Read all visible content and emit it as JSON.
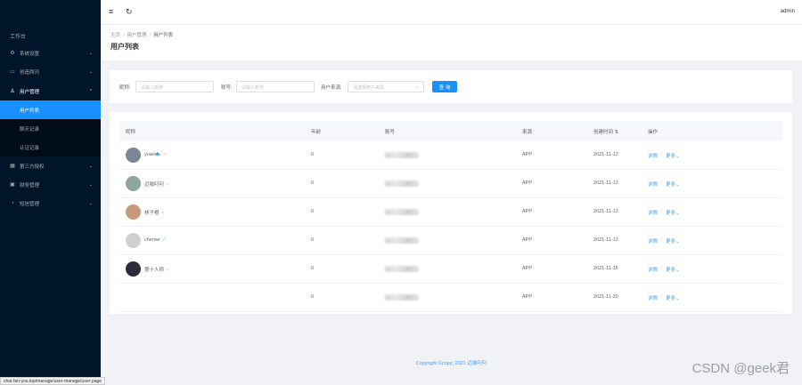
{
  "sidebar": {
    "title": "工作台",
    "items": [
      {
        "label": "系统设置",
        "icon": "gear-icon",
        "glyph": "⚙"
      },
      {
        "label": "创造两河",
        "icon": "monitor-icon",
        "glyph": "▭"
      },
      {
        "label": "用户管理",
        "icon": "user-icon",
        "glyph": "♙"
      },
      {
        "label": "第三方授权",
        "icon": "grid-icon",
        "glyph": "▦"
      },
      {
        "label": "财务管理",
        "icon": "wallet-icon",
        "glyph": "▣"
      },
      {
        "label": "短信管理",
        "icon": "message-icon",
        "glyph": "◔"
      }
    ],
    "sub_items": [
      {
        "label": "用户列表",
        "active": true
      },
      {
        "label": "聊天记录",
        "active": false
      },
      {
        "label": "认证记录",
        "active": false
      }
    ]
  },
  "header": {
    "user": "admin",
    "menu_icon": "≡",
    "refresh_icon": "↻"
  },
  "breadcrumb": {
    "home": "主页",
    "section": "用户管理",
    "current": "用户列表",
    "sep": "/"
  },
  "page_title": "用户列表",
  "search": {
    "nickname_label": "昵称:",
    "nickname_placeholder": "请输入昵称",
    "account_label": "账号:",
    "account_placeholder": "请输入账号",
    "source_label": "用户来源:",
    "source_placeholder": "请选择用户来源",
    "button": "查 询"
  },
  "table": {
    "headers": {
      "nickname": "昵称",
      "age": "年龄",
      "account": "账号",
      "source": "来源",
      "created": "创建时间",
      "sort_icon": "⇅",
      "actions": "操作"
    },
    "rows": [
      {
        "nickname": "yuan🐟",
        "gender": "♂",
        "gender_type": "female",
        "age": "0",
        "source": "APP",
        "created": "2021-11-12",
        "detail": "详情",
        "more": "更多",
        "avatar_color": "#7b8794"
      },
      {
        "nickname": "迈咖叼叼",
        "gender": "♂",
        "gender_type": "female",
        "age": "0",
        "source": "APP",
        "created": "2021-11-13",
        "detail": "详情",
        "more": "更多",
        "avatar_color": "#8fa5a0"
      },
      {
        "nickname": "林子橙",
        "gender": "♂",
        "gender_type": "male",
        "age": "0",
        "source": "APP",
        "created": "2021-11-13",
        "detail": "详情",
        "more": "更多",
        "avatar_color": "#c99a7a"
      },
      {
        "nickname": "chenwr",
        "gender": "♂",
        "gender_type": "male",
        "age": "0",
        "source": "APP",
        "created": "2021-11-13",
        "detail": "详情",
        "more": "更多",
        "avatar_color": "#cfcfcf"
      },
      {
        "nickname": "第十人称",
        "gender": "♂",
        "gender_type": "female",
        "age": "0",
        "source": "APP",
        "created": "2021-11-15",
        "detail": "详情",
        "more": "更多",
        "avatar_color": "#2c2c3a"
      },
      {
        "nickname": "",
        "gender": "",
        "gender_type": "none",
        "age": "0",
        "source": "APP",
        "created": "2021-11-20",
        "detail": "详情",
        "more": "更多",
        "avatar_color": ""
      }
    ]
  },
  "footer": {
    "copyright": "Copyright ©copy; 2021 迈咖叼叼"
  },
  "statusbar": {
    "url": "chat.fan-you.top/manage/user-manage/user-page"
  },
  "watermark": "CSDN @geek君"
}
